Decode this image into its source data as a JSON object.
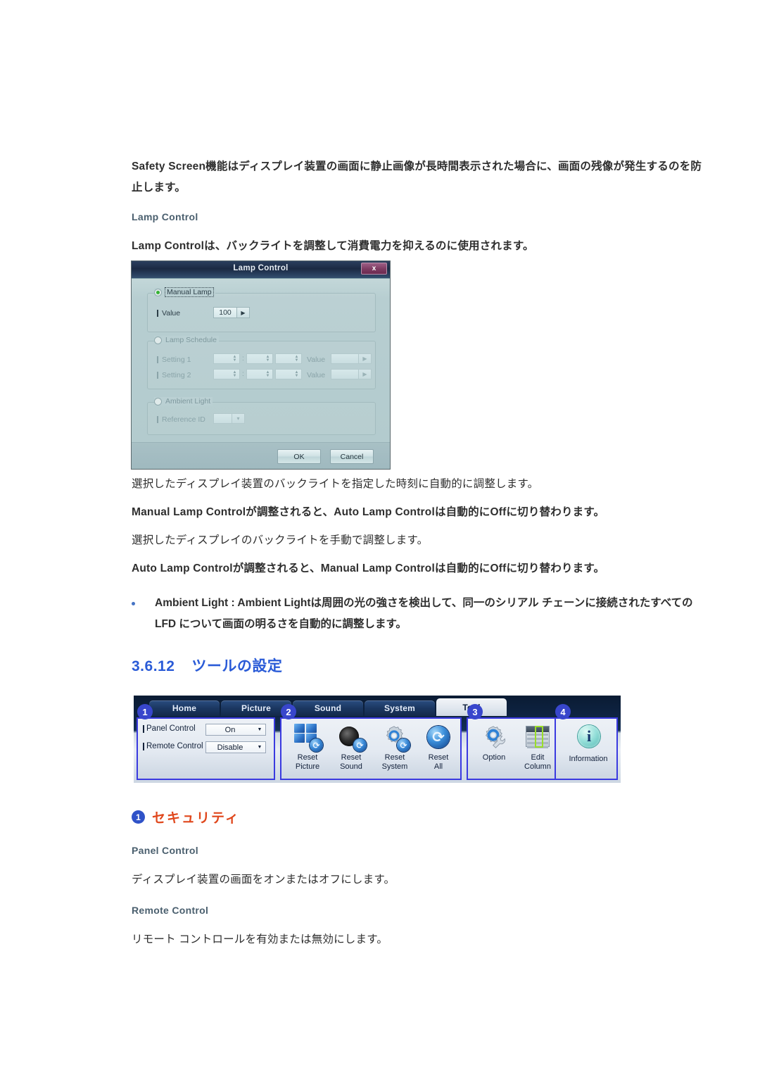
{
  "document": {
    "intro_paragraph": "Safety Screen機能はディスプレイ装置の画面に静止画像が長時間表示された場合に、画面の残像が発生するのを防止します。",
    "lamp_control_label": "Lamp Control",
    "lamp_control_desc": "Lamp Controlは、バックライトを調整して消費電力を抑えるのに使用されます。",
    "after_dialog": {
      "line1": "選択したディスプレイ装置のバックライトを指定した時刻に自動的に調整します。",
      "line2": "Manual Lamp Controlが調整されると、Auto Lamp Controlは自動的にOffに切り替わります。",
      "line3": "選択したディスプレイのバックライトを手動で調整します。",
      "line4": "Auto Lamp Controlが調整されると、Manual Lamp Controlは自動的にOffに切り替わります。",
      "bullet1": "Ambient Light : Ambient Lightは周囲の光の強さを検出して、同一のシリアル チェーンに接続されたすべての LFD について画面の明るさを自動的に調整します。"
    },
    "section": {
      "number": "3.6.12",
      "title": "ツールの設定"
    },
    "security_section": {
      "badge": "1",
      "title": "セキュリティ",
      "items": [
        {
          "label": "Panel Control",
          "desc": "ディスプレイ装置の画面をオンまたはオフにします。"
        },
        {
          "label": "Remote Control",
          "desc": "リモート コントロールを有効または無効にします。"
        }
      ]
    }
  },
  "lamp_dialog": {
    "title": "Lamp Control",
    "close_label": "x",
    "manual_lamp": {
      "group_label": "Manual Lamp",
      "value_label": "Value",
      "value": "100",
      "arrow": "▶",
      "selected": true
    },
    "lamp_schedule": {
      "group_label": "Lamp Schedule",
      "selected": false,
      "rows": [
        {
          "label": "Setting 1",
          "h": "",
          "m": "",
          "s": "",
          "value_label": "Value",
          "value": ""
        },
        {
          "label": "Setting 2",
          "h": "",
          "m": "",
          "s": "",
          "value_label": "Value",
          "value": ""
        }
      ],
      "separator": ":"
    },
    "ambient_light": {
      "group_label": "Ambient Light",
      "reference_id_label": "Reference ID",
      "reference_id_value": "",
      "selected": false
    },
    "buttons": {
      "ok": "OK",
      "cancel": "Cancel"
    }
  },
  "ribbon": {
    "tabs": [
      {
        "label": "Home",
        "active": false
      },
      {
        "label": "Picture",
        "active": false
      },
      {
        "label": "Sound",
        "active": false
      },
      {
        "label": "System",
        "active": false
      },
      {
        "label": "Tool",
        "active": true
      }
    ],
    "groups": [
      {
        "badge": "1",
        "rows": [
          {
            "label": "Panel Control",
            "value": "On"
          },
          {
            "label": "Remote Control",
            "value": "Disable"
          }
        ]
      },
      {
        "badge": "2",
        "items": [
          {
            "label": "Reset\nPicture",
            "icon": "reset-picture-icon"
          },
          {
            "label": "Reset\nSound",
            "icon": "reset-sound-icon"
          },
          {
            "label": "Reset\nSystem",
            "icon": "reset-system-icon"
          },
          {
            "label": "Reset\nAll",
            "icon": "reset-all-icon"
          }
        ]
      },
      {
        "badge": "3",
        "items": [
          {
            "label": "Option",
            "icon": "option-gear-icon"
          },
          {
            "label": "Edit\nColumn",
            "icon": "edit-column-icon"
          }
        ]
      },
      {
        "badge": "4",
        "items": [
          {
            "label": "Information",
            "icon": "information-icon"
          }
        ]
      }
    ]
  },
  "colors": {
    "heading_blue": "#2a5bd7",
    "heading_orange": "#e0471c",
    "badge_blue": "#2f52c8",
    "panel_border": "#3a3ae0",
    "sublabel": "#4a5f6e",
    "bullet": "#4573c4",
    "radio_on": "#35b233"
  }
}
